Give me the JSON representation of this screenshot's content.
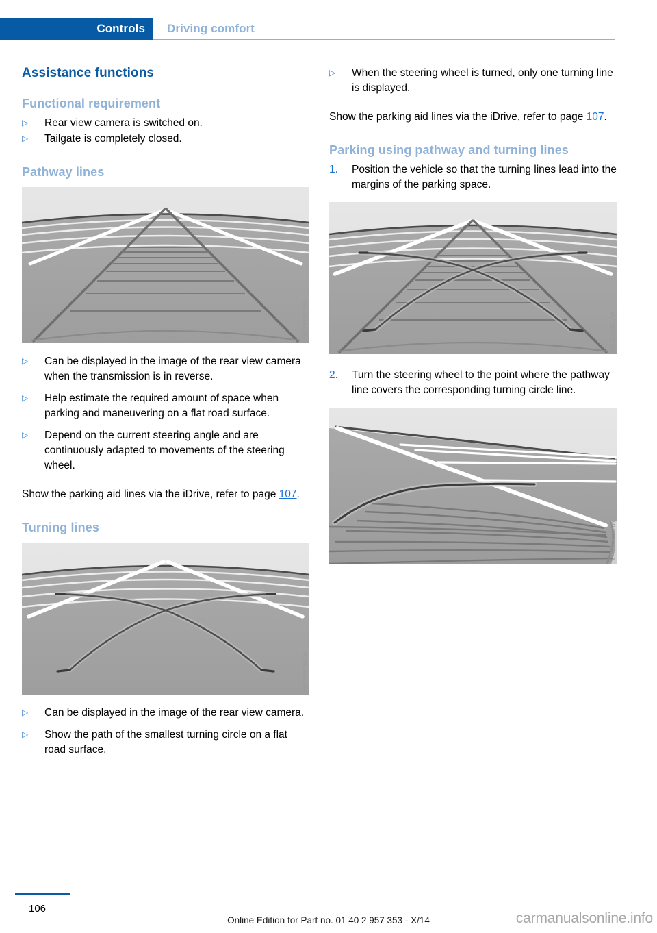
{
  "header": {
    "active_tab": "Controls",
    "secondary_tab": "Driving comfort",
    "accent_color": "#075aa4",
    "secondary_color": "#8fb2d9"
  },
  "left_column": {
    "section_title": "Assistance functions",
    "functional_requirement": {
      "heading": "Functional requirement",
      "items": [
        "Rear view camera is switched on.",
        "Tailgate is completely closed."
      ]
    },
    "pathway_lines": {
      "heading": "Pathway lines",
      "figure_code": "MV08305CMA",
      "items": [
        "Can be displayed in the image of the rear view camera when the transmission is in reverse.",
        "Help estimate the required amount of space when parking and maneuvering on a flat road surface.",
        "Depend on the current steering angle and are continuously adapted to movements of the steering wheel."
      ],
      "note_prefix": "Show the parking aid lines via the iDrive, refer to page ",
      "note_link": "107",
      "note_suffix": "."
    },
    "turning_lines": {
      "heading": "Turning lines",
      "figure_code": "MV08306CMA",
      "items": [
        "Can be displayed in the image of the rear view camera.",
        "Show the path of the smallest turning circle on a flat road surface."
      ]
    }
  },
  "right_column": {
    "top_bullets": [
      "When the steering wheel is turned, only one turning line is displayed."
    ],
    "note_prefix": "Show the parking aid lines via the iDrive, refer to page ",
    "note_link": "107",
    "note_suffix": ".",
    "parking_section": {
      "heading": "Parking using pathway and turning lines",
      "steps": [
        {
          "number": "1.",
          "text": "Position the vehicle so that the turning lines lead into the margins of the parking space.",
          "figure_code": "MV08307CMA"
        },
        {
          "number": "2.",
          "text": "Turn the steering wheel to the point where the pathway line covers the corresponding turning circle line.",
          "figure_code": "MV08308CMA"
        }
      ]
    }
  },
  "footer": {
    "page_number": "106",
    "edition_text": "Online Edition for Part no. 01 40 2 957 353 - X/14",
    "watermark": "carmanualsonline.info"
  },
  "colors": {
    "link": "#1a6fd4",
    "heading_blue": "#0b5ca4",
    "subheading_blue": "#8fb2d9",
    "bullet_blue": "#2f7fd0"
  }
}
